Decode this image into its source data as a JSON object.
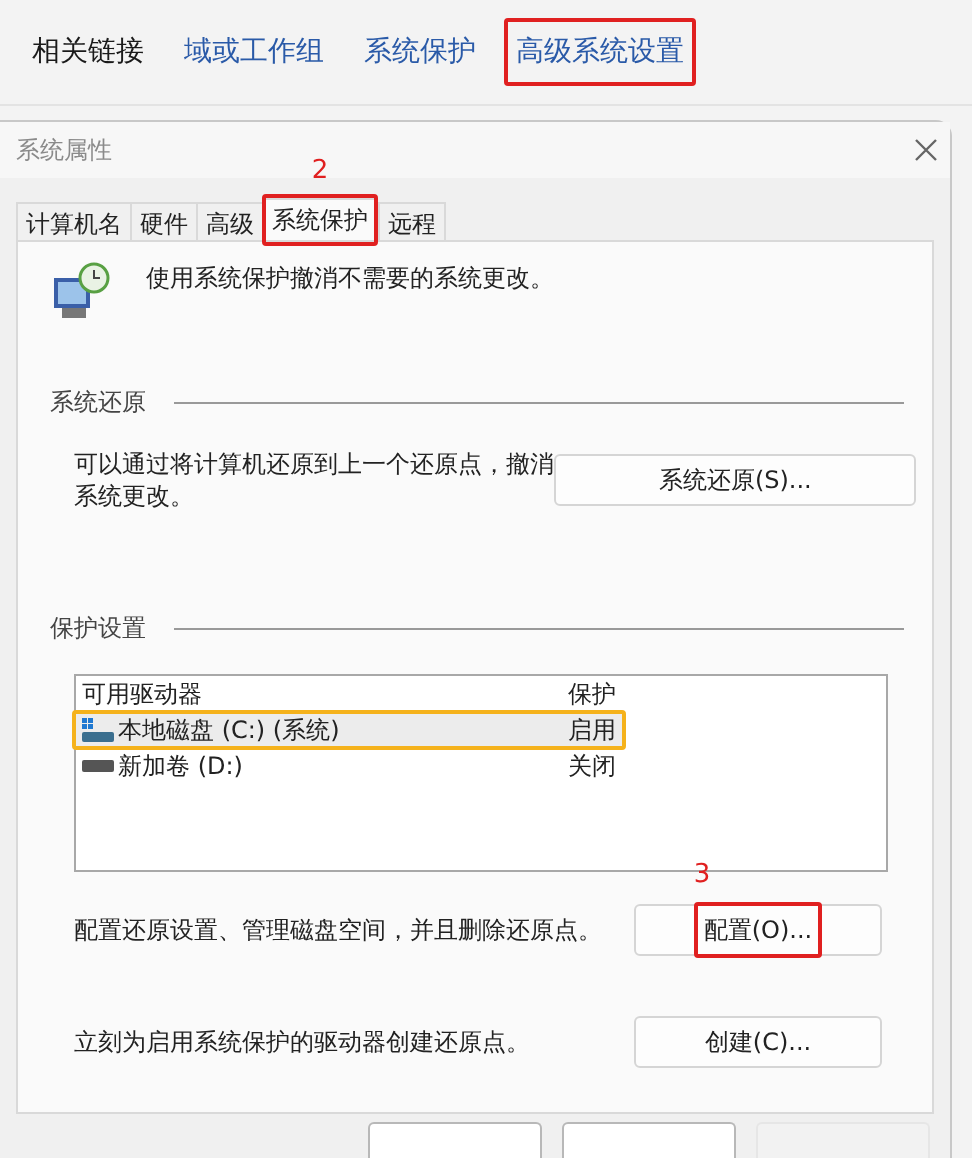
{
  "nav": {
    "label": "相关链接",
    "links": [
      {
        "text": "域或工作组",
        "marked": false
      },
      {
        "text": "系统保护",
        "marked": false
      },
      {
        "text": "高级系统设置",
        "marked": true
      }
    ]
  },
  "dialog": {
    "title": "系统属性",
    "tabs": [
      {
        "label": "计算机名",
        "selected": false,
        "marked": false
      },
      {
        "label": "硬件",
        "selected": false,
        "marked": false
      },
      {
        "label": "高级",
        "selected": false,
        "marked": false
      },
      {
        "label": "系统保护",
        "selected": true,
        "marked": true,
        "callout": "2"
      },
      {
        "label": "远程",
        "selected": false,
        "marked": false
      }
    ],
    "intro": "使用系统保护撤消不需要的系统更改。",
    "restore": {
      "heading": "系统还原",
      "text": "可以通过将计算机还原到上一个还原点，撤消系统更改。",
      "button": "系统还原(S)..."
    },
    "protection": {
      "heading": "保护设置",
      "columns": [
        "可用驱动器",
        "保护"
      ],
      "drives": [
        {
          "name": "本地磁盘 (C:) (系统)",
          "protection": "启用",
          "kind": "system",
          "selected": true,
          "marked": true
        },
        {
          "name": "新加卷 (D:)",
          "protection": "关闭",
          "kind": "data",
          "selected": false,
          "marked": false
        }
      ],
      "configure": {
        "text": "配置还原设置、管理磁盘空间，并且删除还原点。",
        "button": "配置(O)...",
        "marked": true,
        "callout": "3"
      },
      "create": {
        "text": "立刻为启用系统保护的驱动器创建还原点。",
        "button": "创建(C)...",
        "marked": false
      }
    },
    "footer_buttons": [
      {
        "disabled": false
      },
      {
        "disabled": false
      },
      {
        "disabled": true
      }
    ]
  }
}
